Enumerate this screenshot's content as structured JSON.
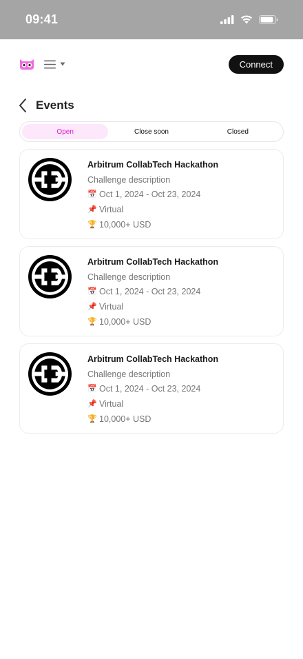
{
  "status_bar": {
    "time": "09:41",
    "icons": [
      "cellular-signal-icon",
      "wifi-icon",
      "battery-icon"
    ]
  },
  "header": {
    "logo_icon": "owl-logo-icon",
    "menu_icon": "hamburger-menu-icon",
    "menu_dropdown_icon": "caret-down-icon",
    "connect_label": "Connect"
  },
  "page": {
    "back_icon": "chevron-left-icon",
    "title": "Events"
  },
  "tabs": [
    {
      "label": "Open",
      "active": true
    },
    {
      "label": "Close soon",
      "active": false
    },
    {
      "label": "Closed",
      "active": false
    }
  ],
  "events": [
    {
      "title": "Arbitrum CollabTech Hackathon",
      "description": "Challenge description",
      "dates": "Oct 1, 2024 - Oct 23, 2024",
      "location": "Virtual",
      "prize": "10,000+ USD",
      "calendar_icon": "calendar-icon",
      "location_icon": "pushpin-icon",
      "prize_icon": "trophy-icon"
    },
    {
      "title": "Arbitrum CollabTech Hackathon",
      "description": "Challenge description",
      "dates": "Oct 1, 2024 - Oct 23, 2024",
      "location": "Virtual",
      "prize": "10,000+ USD",
      "calendar_icon": "calendar-icon",
      "location_icon": "pushpin-icon",
      "prize_icon": "trophy-icon"
    },
    {
      "title": "Arbitrum CollabTech Hackathon",
      "description": "Challenge description",
      "dates": "Oct 1, 2024 - Oct 23, 2024",
      "location": "Virtual",
      "prize": "10,000+ USD",
      "calendar_icon": "calendar-icon",
      "location_icon": "pushpin-icon",
      "prize_icon": "trophy-icon"
    }
  ],
  "colors": {
    "status_bar_bg": "#a5a5a5",
    "accent_pink": "#d71bc7",
    "active_tab_bg": "#fde7fb",
    "logo_pink": "#f06be0",
    "button_bg": "#111111"
  }
}
